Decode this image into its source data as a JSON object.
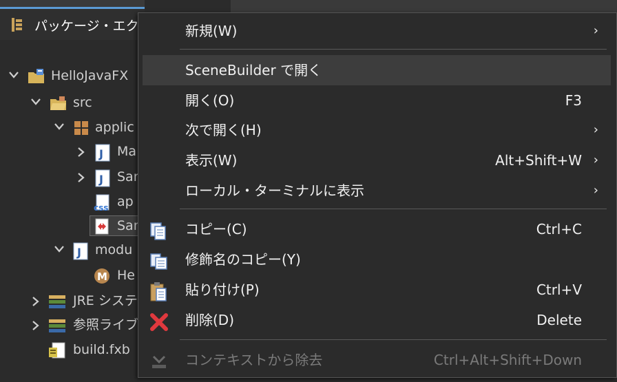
{
  "explorer": {
    "tab_title": "パッケージ・エクス",
    "tree": [
      {
        "label": "HelloJavaFX",
        "icon": "project-icon"
      },
      {
        "label": "src",
        "icon": "source-folder-icon"
      },
      {
        "label": "applic",
        "icon": "package-icon"
      },
      {
        "label": "Ma",
        "icon": "java-file-icon"
      },
      {
        "label": "Sar",
        "icon": "java-file-icon"
      },
      {
        "label": "ap",
        "icon": "css-file-icon"
      },
      {
        "label": "Sar",
        "icon": "fxml-file-icon"
      },
      {
        "label": "modu",
        "icon": "java-file-icon"
      },
      {
        "label": "He",
        "icon": "module-icon"
      },
      {
        "label": "JRE システ",
        "icon": "library-icon"
      },
      {
        "label": "参照ライブ",
        "icon": "library-icon"
      },
      {
        "label": "build.fxb",
        "icon": "build-file-icon"
      }
    ]
  },
  "menu": {
    "items": [
      {
        "label": "新規(W)",
        "accel": "",
        "submenu": true
      },
      {
        "label": "SceneBuilder で開く",
        "accel": "",
        "submenu": false
      },
      {
        "label": "開く(O)",
        "accel": "F3",
        "submenu": false
      },
      {
        "label": "次で開く(H)",
        "accel": "",
        "submenu": true
      },
      {
        "label": "表示(W)",
        "accel": "Alt+Shift+W",
        "submenu": true
      },
      {
        "label": "ローカル・ターミナルに表示",
        "accel": "",
        "submenu": true
      },
      {
        "label": "コピー(C)",
        "accel": "Ctrl+C",
        "submenu": false,
        "icon": "copy-icon"
      },
      {
        "label": "修飾名のコピー(Y)",
        "accel": "",
        "submenu": false,
        "icon": "copy-qualified-name-icon"
      },
      {
        "label": "貼り付け(P)",
        "accel": "Ctrl+V",
        "submenu": false,
        "icon": "paste-icon"
      },
      {
        "label": "削除(D)",
        "accel": "Delete",
        "submenu": false,
        "icon": "delete-icon"
      },
      {
        "label": "コンテキストから除去",
        "accel": "Ctrl+Alt+Shift+Down",
        "submenu": false,
        "icon": "remove-from-context-icon",
        "disabled": true
      }
    ],
    "arrow_glyph": "›"
  },
  "colors": {
    "accent": "#5b9bd5",
    "menu_bg": "#2b2b2b",
    "highlight": "#3d3d3d",
    "delete_red": "#e0393e"
  }
}
